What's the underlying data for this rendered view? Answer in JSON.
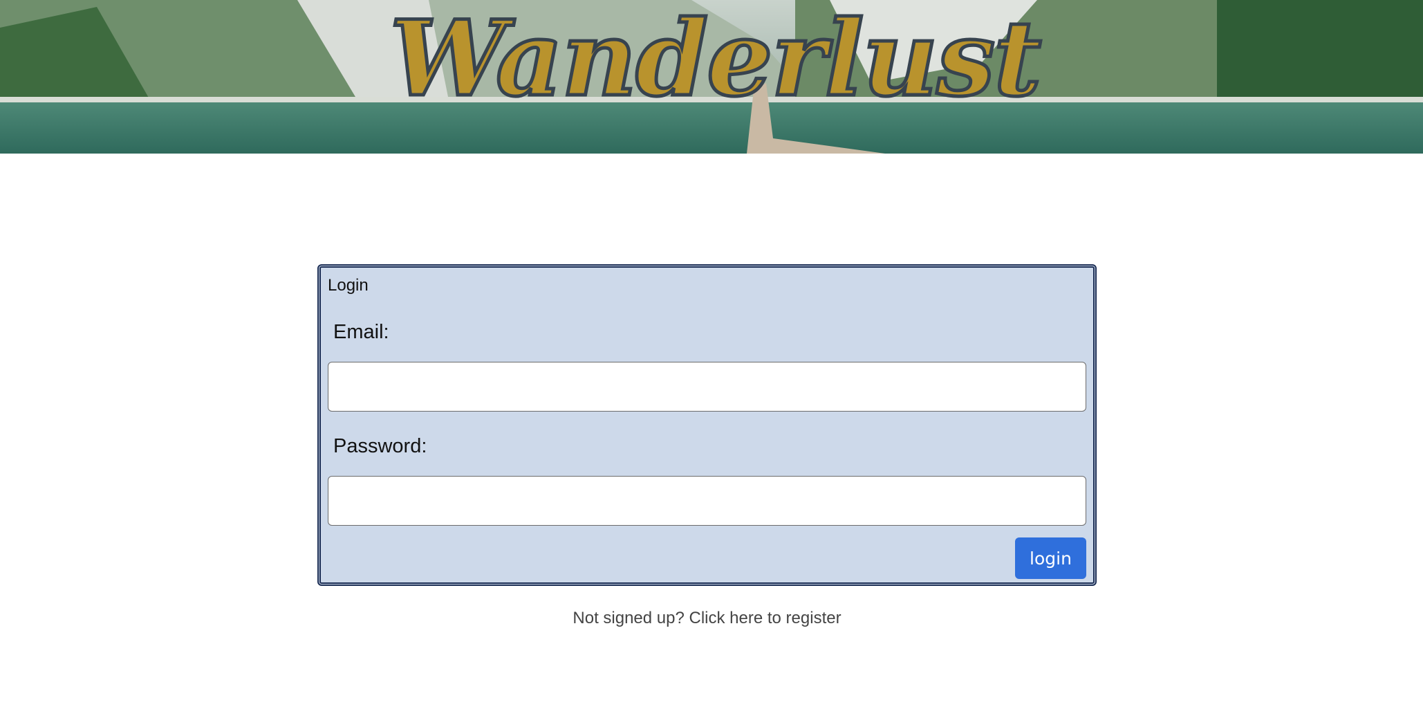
{
  "header": {
    "logo_text": "Wanderlust"
  },
  "login_form": {
    "title": "Login",
    "email_label": "Email:",
    "email_value": "",
    "password_label": "Password:",
    "password_value": "",
    "submit_label": "login"
  },
  "footer": {
    "register_text": "Not signed up? Click here to register"
  },
  "colors": {
    "logo_fill": "#b9932d",
    "logo_outline": "#37434f",
    "card_background": "#cdd9ea",
    "card_border": "#1c2e55",
    "button": "#2f6fdc"
  }
}
